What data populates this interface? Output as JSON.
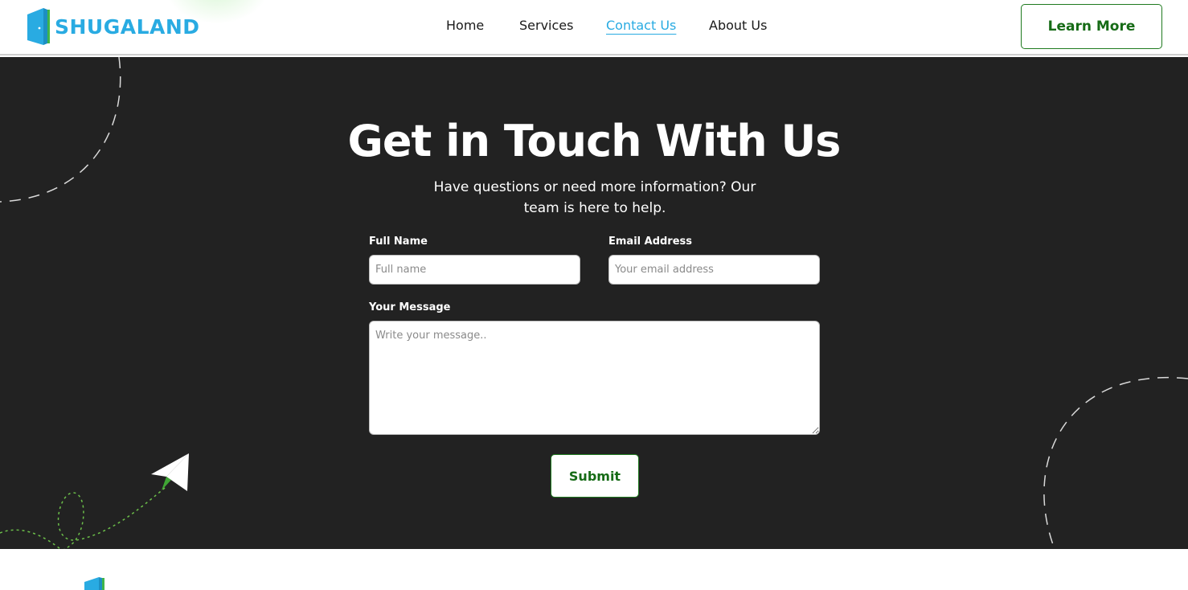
{
  "header": {
    "brand": "SHUGALAND",
    "nav": [
      {
        "label": "Home",
        "active": false
      },
      {
        "label": "Services",
        "active": false
      },
      {
        "label": "Contact Us",
        "active": true
      },
      {
        "label": "About Us",
        "active": false
      }
    ],
    "cta_label": "Learn More"
  },
  "contact": {
    "title": "Get in Touch With Us",
    "subtitle": "Have questions or need more information? Our team is here to help.",
    "full_name_label": "Full Name",
    "full_name_placeholder": "Full name",
    "email_label": "Email Address",
    "email_placeholder": "Your email address",
    "message_label": "Your Message",
    "message_placeholder": "Write your message..",
    "submit_label": "Submit"
  },
  "colors": {
    "brand_blue": "#29ABE2",
    "accent_green": "#1f7a1f",
    "dark_bg": "#222222"
  },
  "icons": [
    "door-logo-icon",
    "paper-plane-icon"
  ]
}
